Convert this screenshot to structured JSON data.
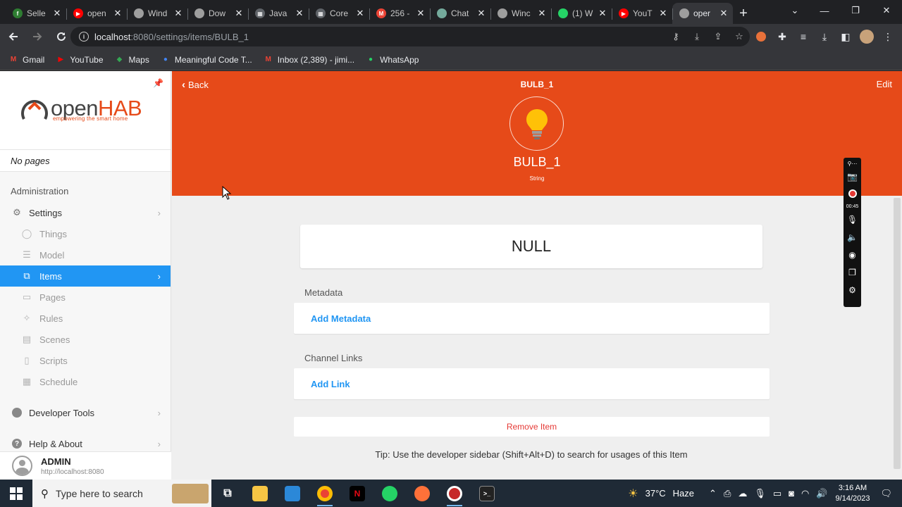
{
  "browser": {
    "tabs": [
      {
        "label": "Selle",
        "color": "#2e7d32",
        "glyph": "f"
      },
      {
        "label": "open",
        "color": "#ff0000",
        "glyph": "▶"
      },
      {
        "label": "Wind",
        "color": "#9e9e9e",
        "glyph": ""
      },
      {
        "label": "Dow",
        "color": "#9e9e9e",
        "glyph": ""
      },
      {
        "label": "Java",
        "color": "#5f6368",
        "glyph": "▦"
      },
      {
        "label": "Core",
        "color": "#5f6368",
        "glyph": "▦"
      },
      {
        "label": "256 -",
        "color": "#ea4335",
        "glyph": "M"
      },
      {
        "label": "Chat",
        "color": "#74aa9c",
        "glyph": ""
      },
      {
        "label": "Winc",
        "color": "#9e9e9e",
        "glyph": ""
      },
      {
        "label": "(1) W",
        "color": "#25d366",
        "glyph": ""
      },
      {
        "label": "YouT",
        "color": "#ff0000",
        "glyph": "▶"
      },
      {
        "label": "oper",
        "color": "#9e9e9e",
        "glyph": "",
        "active": true
      }
    ],
    "url_host": "localhost",
    "url_path": ":8080/settings/items/BULB_1",
    "bookmarks": [
      {
        "label": "Gmail",
        "color": "#ea4335",
        "glyph": "M"
      },
      {
        "label": "YouTube",
        "color": "#ff0000",
        "glyph": "▶"
      },
      {
        "label": "Maps",
        "color": "#34a853",
        "glyph": "◆"
      },
      {
        "label": "Meaningful Code T...",
        "color": "#4285f4",
        "glyph": "●"
      },
      {
        "label": "Inbox (2,389) - jimi...",
        "color": "#ea4335",
        "glyph": "M"
      },
      {
        "label": "WhatsApp",
        "color": "#25d366",
        "glyph": "●"
      }
    ]
  },
  "sidebar": {
    "logo_open": "open",
    "logo_hab": "HAB",
    "logo_tagline": "empowering the smart home",
    "no_pages": "No pages",
    "admin_title": "Administration",
    "settings": "Settings",
    "sub_items": [
      {
        "label": "Things",
        "icon": "lightbulb-icon",
        "glyph": "◯"
      },
      {
        "label": "Model",
        "icon": "list-icon",
        "glyph": "☰"
      },
      {
        "label": "Items",
        "icon": "items-icon",
        "glyph": "⧉",
        "active": true
      },
      {
        "label": "Pages",
        "icon": "monitor-icon",
        "glyph": "▭"
      },
      {
        "label": "Rules",
        "icon": "wand-icon",
        "glyph": "✧"
      },
      {
        "label": "Scenes",
        "icon": "film-icon",
        "glyph": "▤"
      },
      {
        "label": "Scripts",
        "icon": "script-icon",
        "glyph": "▯"
      },
      {
        "label": "Schedule",
        "icon": "calendar-icon",
        "glyph": "▦"
      }
    ],
    "developer_tools": "Developer Tools",
    "help_about": "Help & About",
    "user_name": "ADMIN",
    "user_url": "http://localhost:8080"
  },
  "item_page": {
    "back": "Back",
    "title": "BULB_1",
    "edit": "Edit",
    "item_name": "BULB_1",
    "item_type": "String",
    "state": "NULL",
    "metadata_label": "Metadata",
    "add_metadata": "Add Metadata",
    "channel_links_label": "Channel Links",
    "add_link": "Add Link",
    "remove_item": "Remove Item",
    "tip": "Tip: Use the developer sidebar (Shift+Alt+D) to search for usages of this Item"
  },
  "recorder": {
    "time": "00:45"
  },
  "taskbar": {
    "search_placeholder": "Type here to search",
    "weather_temp": "37°C",
    "weather_desc": "Haze",
    "time": "3:16 AM",
    "date": "9/14/2023"
  },
  "colors": {
    "accent": "#e64a19",
    "link": "#2196f3",
    "active_nav": "#2196f3",
    "danger": "#e53935"
  }
}
